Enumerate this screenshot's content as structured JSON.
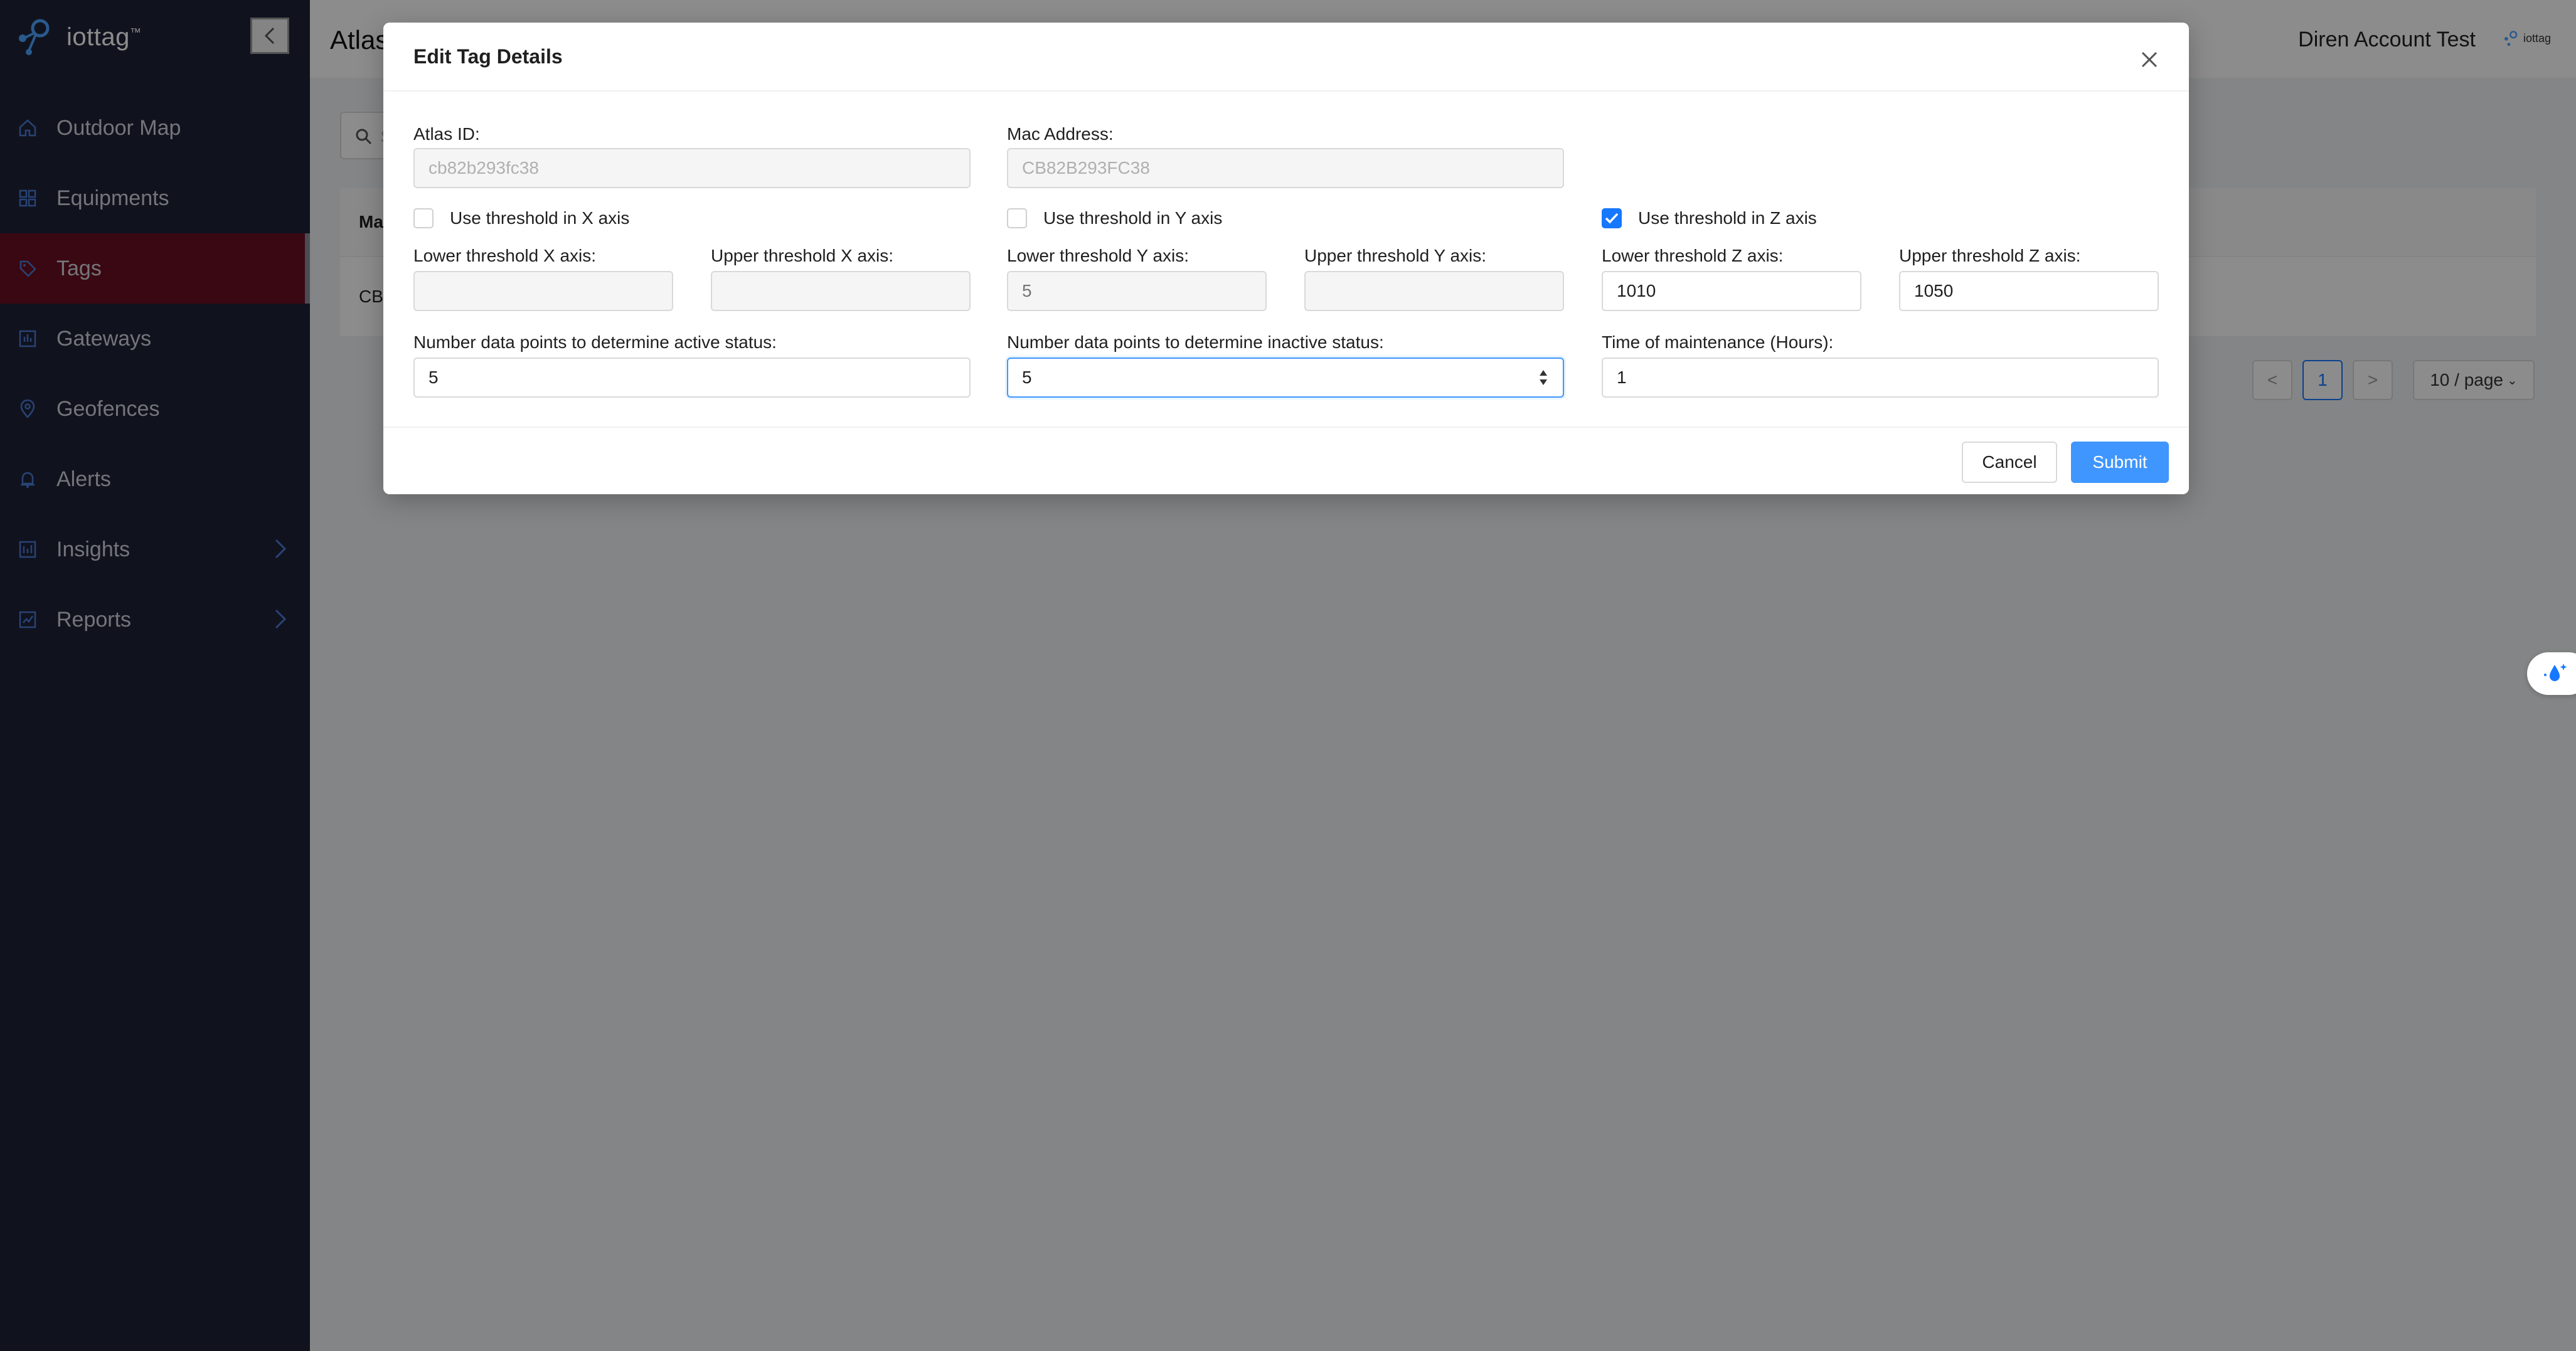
{
  "app": {
    "brand": "iottag",
    "brand_mark": "™"
  },
  "sidebar": {
    "items": [
      {
        "label": "Outdoor Map",
        "icon": "home-icon"
      },
      {
        "label": "Equipments",
        "icon": "grid-icon"
      },
      {
        "label": "Tags",
        "icon": "tag-icon"
      },
      {
        "label": "Gateways",
        "icon": "gateway-icon"
      },
      {
        "label": "Geofences",
        "icon": "location-pin-icon"
      },
      {
        "label": "Alerts",
        "icon": "bell-icon"
      },
      {
        "label": "Insights",
        "icon": "insights-icon"
      },
      {
        "label": "Reports",
        "icon": "reports-icon"
      }
    ],
    "active_item": "Tags"
  },
  "header": {
    "page_title": "Atlas",
    "account_name": "Diren Account Test",
    "account_logo_text": "iottag"
  },
  "background_table": {
    "header_cell": "Ma",
    "row_cell": "CB",
    "search_placeholder": "S"
  },
  "pagination": {
    "prev": "<",
    "current_page": "1",
    "next": ">",
    "page_size": "10 / page"
  },
  "modal": {
    "title": "Edit Tag Details",
    "atlas_id_label": "Atlas ID:",
    "atlas_id_value": "cb82b293fc38",
    "mac_address_label": "Mac Address:",
    "mac_address_value": "CB82B293FC38",
    "use_x_label": "Use threshold in X axis",
    "use_x_checked": false,
    "use_y_label": "Use threshold in Y axis",
    "use_y_checked": false,
    "use_z_label": "Use threshold in Z axis",
    "use_z_checked": true,
    "lower_x_label": "Lower threshold X axis:",
    "lower_x_value": "",
    "upper_x_label": "Upper threshold X axis:",
    "upper_x_value": "",
    "lower_y_label": "Lower threshold Y axis:",
    "lower_y_placeholder": "5",
    "upper_y_label": "Upper threshold Y axis:",
    "upper_y_value": "",
    "lower_z_label": "Lower threshold Z axis:",
    "lower_z_value": "1010",
    "upper_z_label": "Upper threshold Z axis:",
    "upper_z_value": "1050",
    "active_points_label": "Number data points to determine active status:",
    "active_points_value": "5",
    "inactive_points_label": "Number data points to determine inactive status:",
    "inactive_points_value": "5",
    "maintenance_label": "Time of maintenance (Hours):",
    "maintenance_value": "1",
    "cancel_label": "Cancel",
    "submit_label": "Submit"
  },
  "colors": {
    "sidebar_bg": "#1e2337",
    "active_item_bg": "#6b0f22",
    "primary": "#4096ff",
    "checkbox_checked": "#1677ff"
  }
}
